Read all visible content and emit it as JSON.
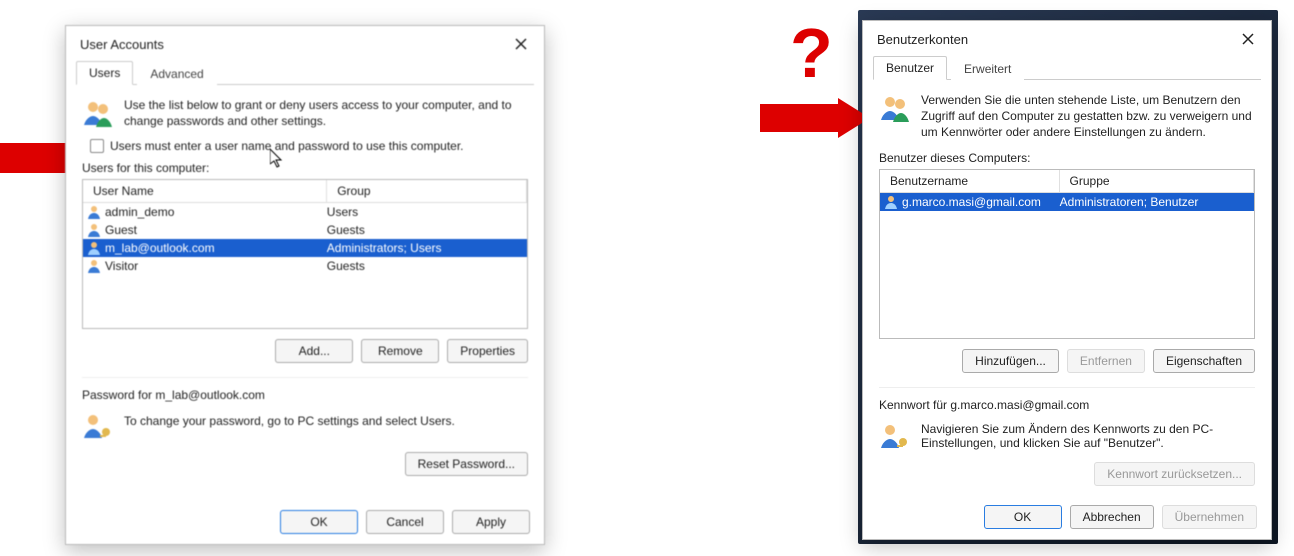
{
  "annotations": {
    "question_mark": "?"
  },
  "en": {
    "title": "User Accounts",
    "tabs": {
      "users": "Users",
      "advanced": "Advanced"
    },
    "intro": "Use the list below to grant or deny users access to your computer, and to change passwords and other settings.",
    "checkbox_label": "Users must enter a user name and password to use this computer.",
    "users_for_label": "Users for this computer:",
    "columns": {
      "name": "User Name",
      "group": "Group"
    },
    "rows": [
      {
        "name": "admin_demo",
        "group": "Users"
      },
      {
        "name": "Guest",
        "group": "Guests"
      },
      {
        "name": "m_lab@outlook.com",
        "group": "Administrators; Users"
      },
      {
        "name": "Visitor",
        "group": "Guests"
      }
    ],
    "buttons": {
      "add": "Add...",
      "remove": "Remove",
      "properties": "Properties"
    },
    "pw_header": "Password for m_lab@outlook.com",
    "pw_text": "To change your password, go to PC settings and select Users.",
    "reset_pw": "Reset Password...",
    "footer": {
      "ok": "OK",
      "cancel": "Cancel",
      "apply": "Apply"
    }
  },
  "de": {
    "title": "Benutzerkonten",
    "tabs": {
      "users": "Benutzer",
      "advanced": "Erweitert"
    },
    "intro": "Verwenden Sie die unten stehende Liste, um Benutzern den Zugriff auf den Computer zu gestatten bzw. zu verweigern und um Kennwörter oder andere Einstellungen zu ändern.",
    "users_for_label": "Benutzer dieses Computers:",
    "columns": {
      "name": "Benutzername",
      "group": "Gruppe"
    },
    "rows": [
      {
        "name": "g.marco.masi@gmail.com",
        "group": "Administratoren; Benutzer"
      }
    ],
    "buttons": {
      "add": "Hinzufügen...",
      "remove": "Entfernen",
      "properties": "Eigenschaften"
    },
    "pw_header": "Kennwort für g.marco.masi@gmail.com",
    "pw_text": "Navigieren Sie zum Ändern des Kennworts zu den PC-Einstellungen, und klicken Sie auf \"Benutzer\".",
    "reset_pw": "Kennwort zurücksetzen...",
    "footer": {
      "ok": "OK",
      "cancel": "Abbrechen",
      "apply": "Übernehmen"
    }
  }
}
